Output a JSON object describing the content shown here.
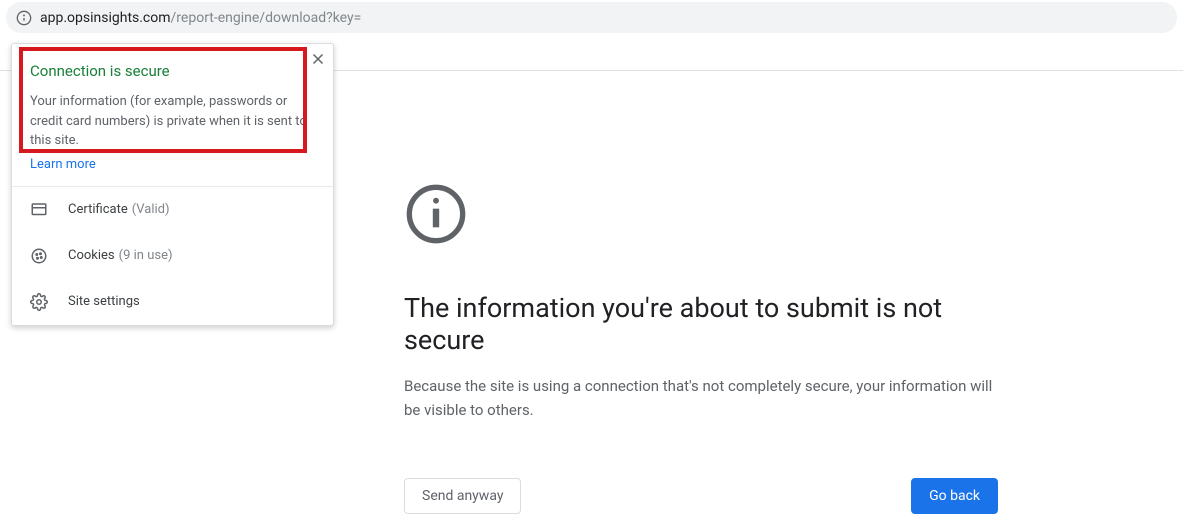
{
  "address_bar": {
    "host": "app.opsinsights.com",
    "path": "/report-engine/download?key="
  },
  "popover": {
    "title": "Connection is secure",
    "description": "Your information (for example, passwords or credit card numbers) is private when it is sent to this site.",
    "learn_more": "Learn more",
    "rows": {
      "certificate": {
        "label": "Certificate",
        "sub": "(Valid)"
      },
      "cookies": {
        "label": "Cookies",
        "sub": "(9 in use)"
      },
      "settings": {
        "label": "Site settings"
      }
    }
  },
  "interstitial": {
    "title": "The information you're about to submit is not secure",
    "description": "Because the site is using a connection that's not completely secure, your information will be visible to others.",
    "send_anyway": "Send anyway",
    "go_back": "Go back"
  }
}
